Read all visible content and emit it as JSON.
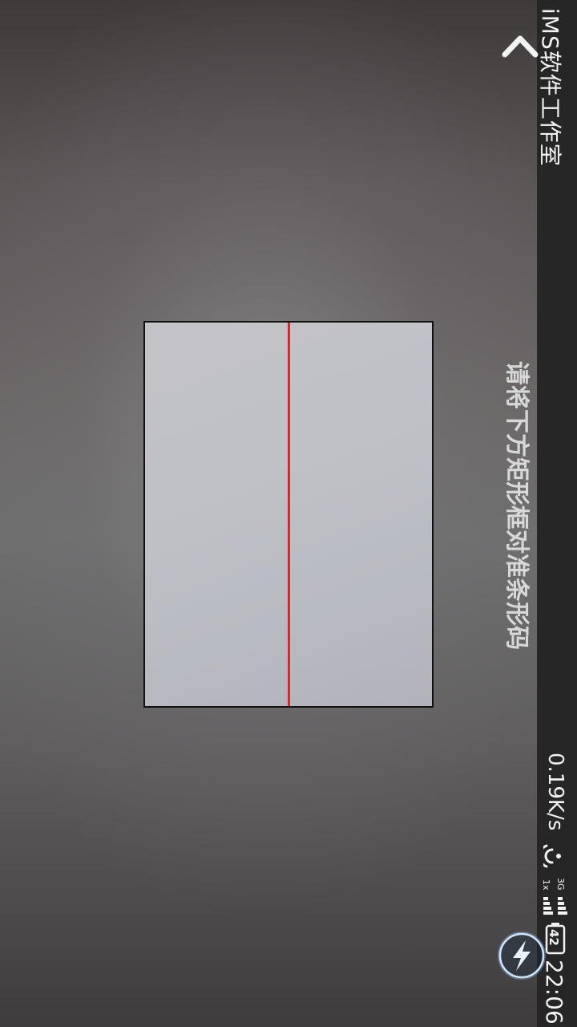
{
  "status_bar": {
    "app_title": "iMS软件工作室",
    "net_speed": "0.19K/s",
    "network_type": "3G",
    "sim_label": "1x",
    "battery_level": "42",
    "time": "22:06",
    "icons": [
      "back-arrow-icon",
      "wifi-icon",
      "cell-signal-icon",
      "battery-icon"
    ]
  },
  "scanner": {
    "instruction": "请将下方矩形框对准条形码",
    "scan_line_color": "#d8282a",
    "frame_color": "#111111"
  },
  "controls": {
    "flash_icon": "lightning-icon"
  }
}
